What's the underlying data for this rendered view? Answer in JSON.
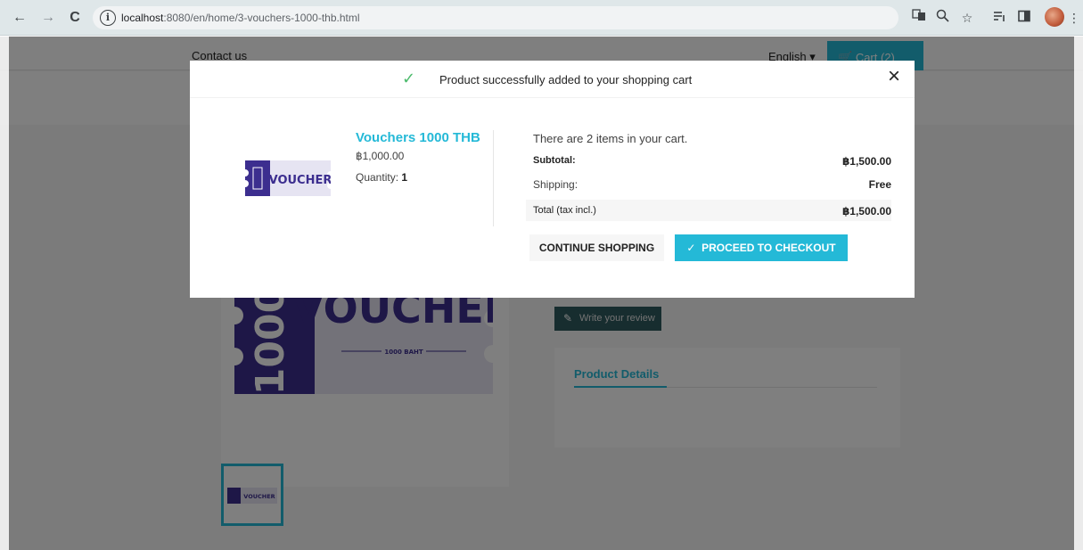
{
  "browser": {
    "url_host": "localhost",
    "url_path": ":8080/en/home/3-vouchers-1000-thb.html"
  },
  "page": {
    "contact_label": "Contact us",
    "language_label": "English ▾",
    "cart_label": "Cart (2)",
    "review_button_label": "Write your review",
    "tab_product_details": "Product Details",
    "voucher_big_text": "VOUCHER",
    "voucher_big_sub": "1000 BAHT"
  },
  "modal": {
    "title": "Product successfully added to your shopping cart",
    "close_symbol": "×",
    "product": {
      "name": "Vouchers 1000 THB",
      "price": "฿1,000.00",
      "quantity_label": "Quantity:",
      "quantity_value": "1",
      "image_text": "VOUCHER"
    },
    "cart": {
      "count_text": "There are 2 items in your cart.",
      "subtotal_label": "Subtotal:",
      "subtotal_value": "฿1,500.00",
      "shipping_label": "Shipping:",
      "shipping_value": "Free",
      "total_label": "Total (tax incl.)",
      "total_value": "฿1,500.00"
    },
    "continue_button": "CONTINUE SHOPPING",
    "checkout_button": "PROCEED TO CHECKOUT"
  },
  "colors": {
    "accent": "#24b9d7",
    "success": "#4cbb6c",
    "voucher_purple": "#3c2e8f"
  }
}
